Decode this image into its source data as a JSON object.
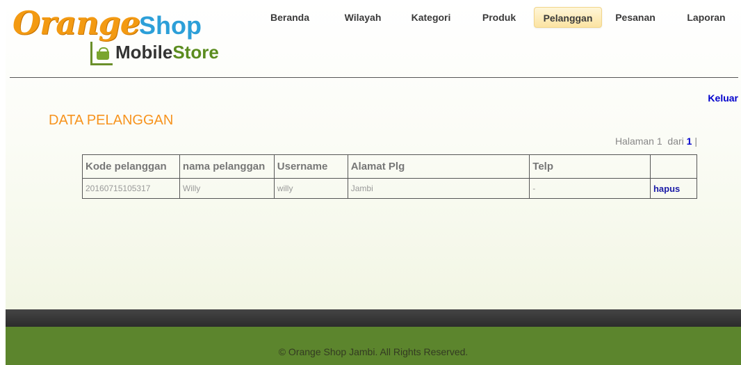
{
  "logo": {
    "orange": "Orange",
    "shop": "Shop",
    "mobile": "Mobile",
    "store": "Store",
    "icon": "basket-icon"
  },
  "nav": {
    "items": [
      "Beranda",
      "Wilayah",
      "Kategori",
      "Produk",
      "Pelanggan",
      "Pesanan",
      "Laporan"
    ],
    "active": "Pelanggan"
  },
  "logout": "Keluar",
  "page_title": "DATA PELANGGAN",
  "pager": {
    "prefix": "Halaman 1",
    "of_label": "dari",
    "current": "1",
    "separator": "|"
  },
  "table": {
    "headers": [
      "Kode pelanggan",
      "nama pelanggan",
      "Username",
      "Alamat Plg",
      "Telp",
      ""
    ],
    "rows": [
      {
        "kode": "20160715105317",
        "nama": "Willy",
        "username": "willy",
        "alamat": "Jambi",
        "telp": "-",
        "action": "hapus"
      }
    ]
  },
  "footer": {
    "copyright": "© Orange Shop Jambi. All Rights Reserved."
  },
  "colors": {
    "accent_orange": "#f7931e",
    "link_blue": "#0000cc",
    "footer_green": "#5c852d",
    "footer_dark": "#2c2c2c"
  }
}
